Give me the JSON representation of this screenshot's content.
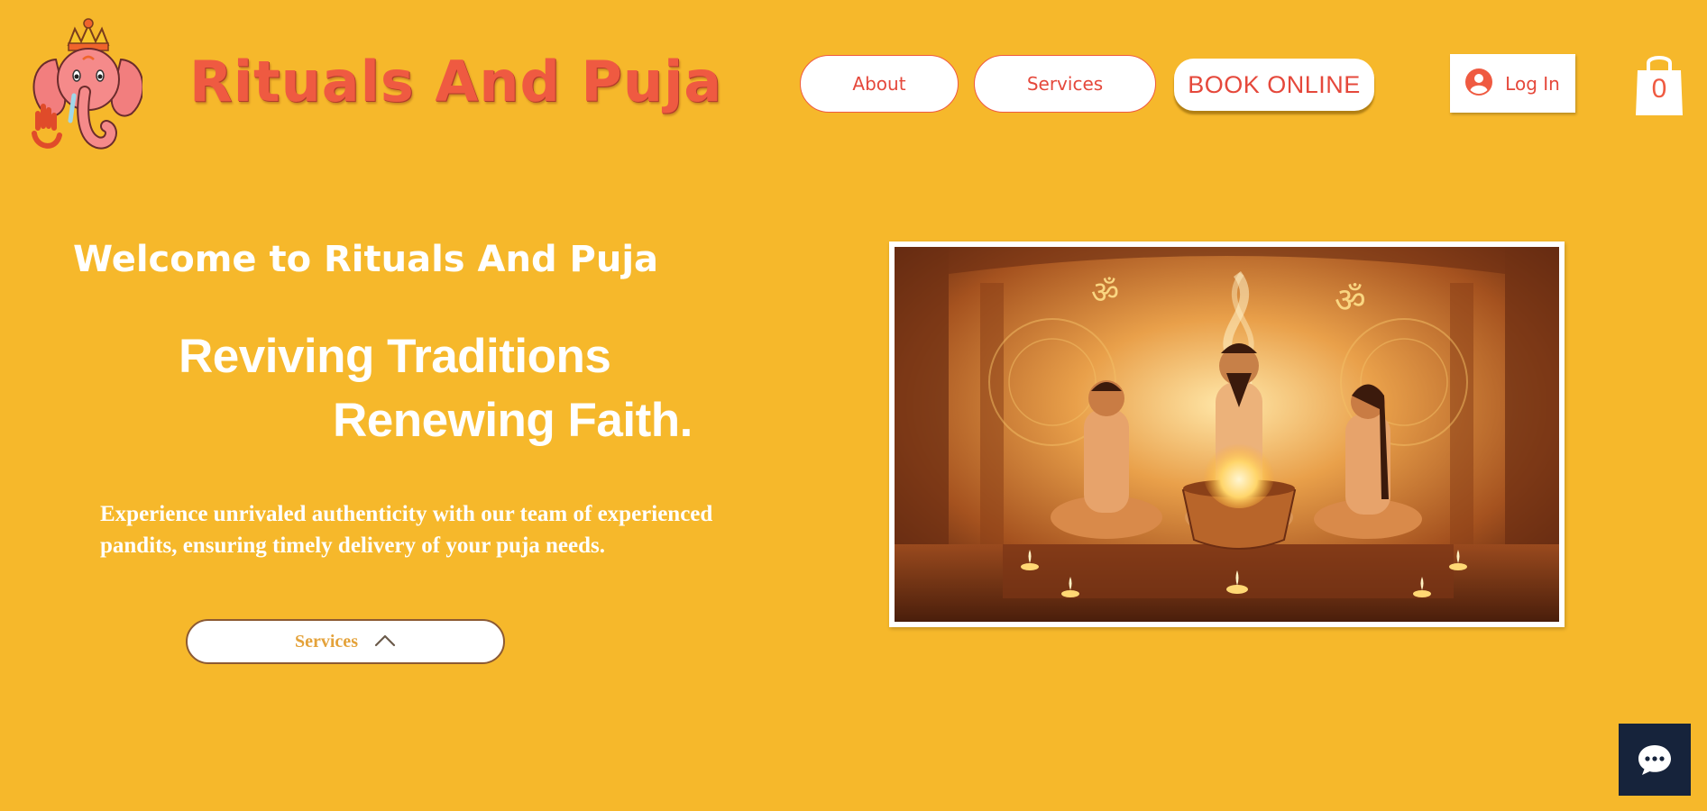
{
  "header": {
    "site_title": "Rituals And Puja",
    "nav": [
      {
        "label": "About"
      },
      {
        "label": "Services"
      }
    ],
    "book_label": "BOOK ONLINE",
    "login_label": "Log In",
    "cart_count": "0",
    "logo_icon": "ganesha-logo-icon"
  },
  "hero": {
    "welcome": "Welcome to Rituals And Puja",
    "tagline_line1": "Reviving Traditions",
    "tagline_line2": "Renewing Faith.",
    "description": "Experience unrivaled authenticity with our team of experienced pandits, ensuring timely delivery of your puja needs.",
    "cta_label": "Services",
    "image_icon": "puja-ritual-illustration"
  },
  "colors": {
    "background": "#F6B82B",
    "accent": "#EF5A41",
    "chat": "#16233B"
  }
}
